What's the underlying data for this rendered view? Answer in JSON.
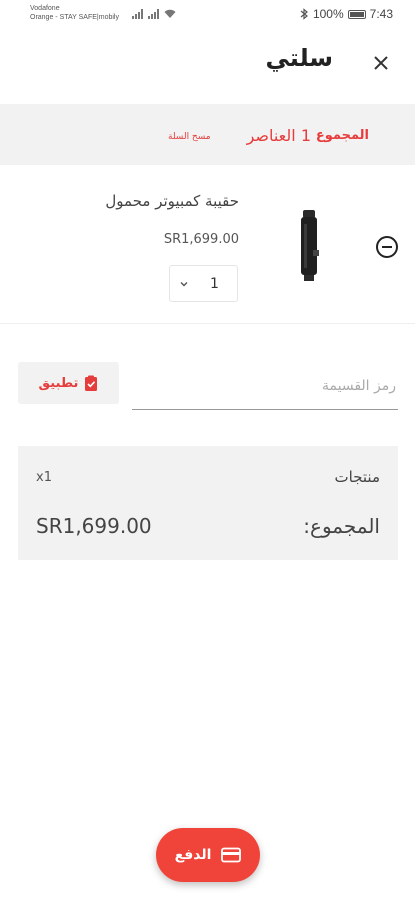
{
  "status_bar": {
    "carrier_line1": "Vodafone",
    "carrier_line2": "Orange - STAY SAFE|mobily",
    "battery": "100%",
    "time": "7:43"
  },
  "header": {
    "title": "سلتي",
    "close_icon": "close-icon"
  },
  "summary": {
    "total_label": "المجموع",
    "items_count": "1 العناصر",
    "clear_cart": "مسح السلة"
  },
  "cart_items": [
    {
      "name": "حقيبة كمبيوتر محمول",
      "price": "SR1,699.00",
      "quantity": "1"
    }
  ],
  "coupon": {
    "placeholder": "رمز القسيمة",
    "apply_label": "تطبيق"
  },
  "totals": {
    "products_label": "منتجات",
    "products_qty": "x1",
    "sum_label": "المجموع:",
    "sum_value": "SR1,699.00"
  },
  "checkout": {
    "label": "الدفع"
  },
  "colors": {
    "accent": "#e63c3c",
    "fab": "#f0443a",
    "panel": "#f2f2f2"
  }
}
